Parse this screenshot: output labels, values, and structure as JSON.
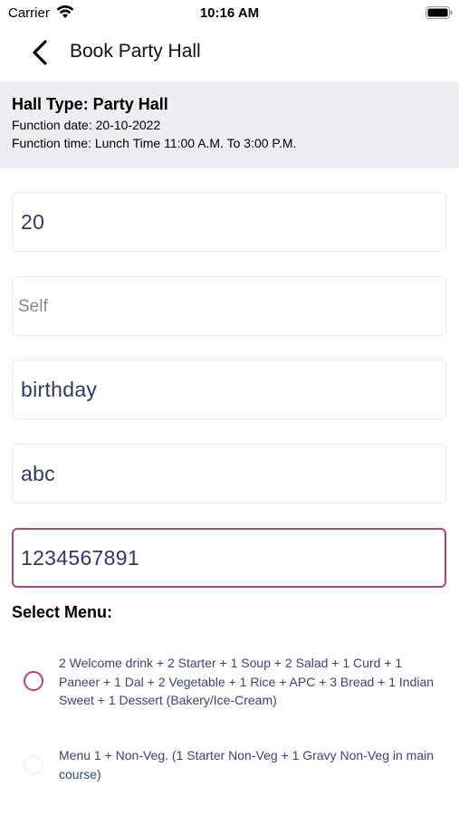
{
  "status_bar": {
    "carrier": "Carrier",
    "time": "10:16 AM"
  },
  "nav": {
    "title": "Book Party Hall",
    "back_icon": "chevron-left-icon"
  },
  "info": {
    "hall_type": "Hall Type: Party Hall",
    "function_date": "Function date: 20-10-2022",
    "function_time": "Function time: Lunch Time 11:00 A.M. To 3:00 P.M."
  },
  "form": {
    "guests_value": "20",
    "name_placeholder": "Self",
    "occasion_value": "birthday",
    "address_value": "abc",
    "phone_value": "1234567891"
  },
  "menu": {
    "title": "Select Menu:",
    "options": [
      {
        "label": "2 Welcome drink + 2 Starter + 1 Soup +  2 Salad + 1 Curd + 1 Paneer  + 1 Dal + 2 Vegetable + 1 Rice + APC + 3 Bread + 1 Indian Sweet + 1 Dessert (Bakery/Ice-Cream)",
        "selected": false
      },
      {
        "label": "Menu 1 + Non-Veg. (1 Starter Non-Veg + 1 Gravy Non-Veg in main course)",
        "selected": false
      }
    ]
  },
  "colors": {
    "accent": "#b2457a",
    "input_text": "#2e3a66",
    "panel_bg": "#eeeef2"
  }
}
